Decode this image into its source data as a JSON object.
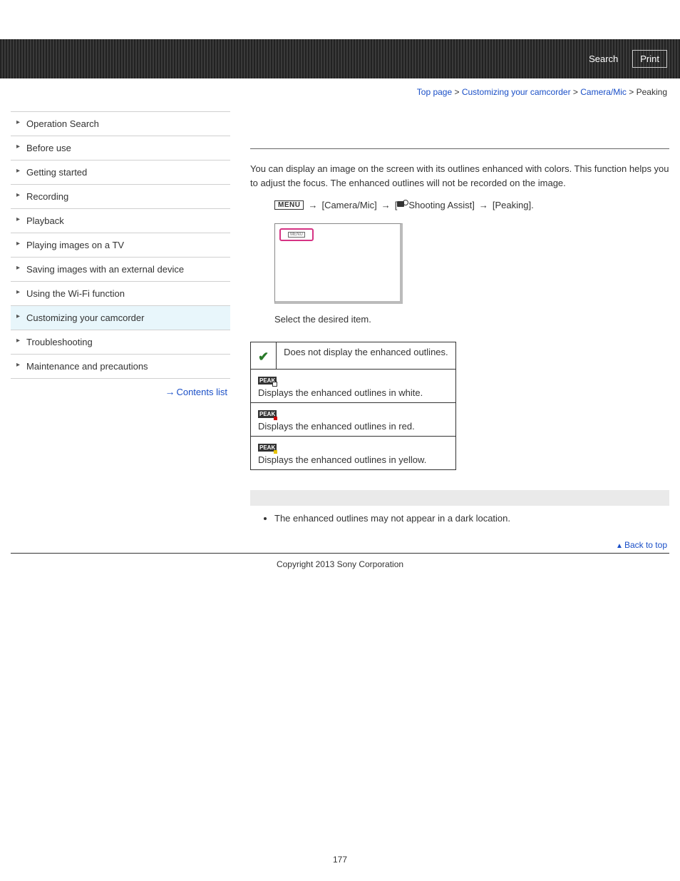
{
  "header": {
    "search": "Search",
    "print": "Print"
  },
  "breadcrumb": {
    "top": "Top page",
    "sec1": "Customizing your camcorder",
    "sec2": "Camera/Mic",
    "current": "Peaking",
    "sep": " > "
  },
  "nav": {
    "items": [
      "Operation Search",
      "Before use",
      "Getting started",
      "Recording",
      "Playback",
      "Playing images on a TV",
      "Saving images with an external device",
      "Using the Wi-Fi function",
      "Customizing your camcorder",
      "Troubleshooting",
      "Maintenance and precautions"
    ],
    "contents_link": "Contents list"
  },
  "article": {
    "intro": "You can display an image on the screen with its outlines enhanced with colors. This function helps you to adjust the focus. The enhanced outlines will not be recorded on the image.",
    "menu_label": "MENU",
    "path1": "[Camera/Mic]",
    "path2_suffix": "Shooting Assist]",
    "path2_prefix": "[",
    "path3": "[Peaking].",
    "pink_inner": "MENU",
    "select_text": "Select the desired item.",
    "options": [
      {
        "icon": "check",
        "desc": "Does not display the enhanced outlines."
      },
      {
        "icon": "peak-w",
        "desc": "Displays the enhanced outlines in white."
      },
      {
        "icon": "peak-r",
        "desc": "Displays the enhanced outlines in red."
      },
      {
        "icon": "peak-y",
        "desc": "Displays the enhanced outlines in yellow."
      }
    ],
    "peak_label": "PEAK",
    "note": "The enhanced outlines may not appear in a dark location.",
    "back_to_top": "Back to top"
  },
  "footer": {
    "copyright": "Copyright 2013 Sony Corporation",
    "page": "177"
  }
}
